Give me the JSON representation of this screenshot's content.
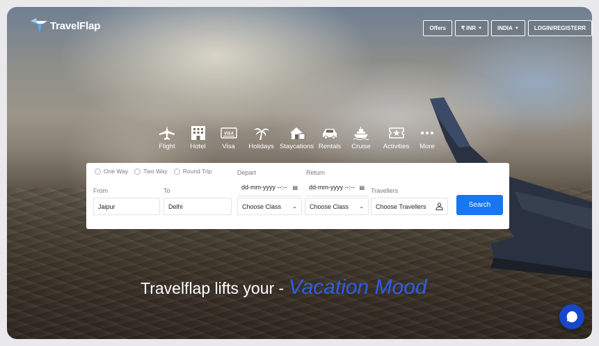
{
  "header": {
    "brand": "TravelFlap",
    "buttons": {
      "offers": "Offers",
      "currency": "₹ INR",
      "country": "INDIA",
      "login": "LOGIN/REGISTERR"
    }
  },
  "categories": [
    {
      "label": "Flight",
      "icon": "plane-icon"
    },
    {
      "label": "Hotel",
      "icon": "building-icon"
    },
    {
      "label": "Visa",
      "icon": "visa-card-icon"
    },
    {
      "label": "Holidays",
      "icon": "palm-tree-icon"
    },
    {
      "label": "Staycations",
      "icon": "house-icon"
    },
    {
      "label": "Rentals",
      "icon": "car-icon"
    },
    {
      "label": "Cruise",
      "icon": "ship-icon"
    },
    {
      "label": "Activities",
      "icon": "ticket-star-icon"
    },
    {
      "label": "More",
      "icon": "dots-icon"
    }
  ],
  "search": {
    "trip_types": [
      "One Way",
      "Two Way",
      "Round Trip"
    ],
    "labels": {
      "from": "From",
      "to": "To",
      "depart": "Depart",
      "return": "Return",
      "travellers": "Travellers"
    },
    "from_value": "Jaipur",
    "to_value": "Delhi",
    "depart_placeholder": "dd-mm-yyyy --:--",
    "return_placeholder": "dd-mm-yyyy --:--",
    "depart_class": "Choose Class",
    "return_class": "Choose Class",
    "travellers_value": "Choose Travellers",
    "submit": "Search"
  },
  "tagline": {
    "prefix": "Travelflap lifts your - ",
    "highlight": "Vacation Mood"
  },
  "colors": {
    "accent": "#1677f0",
    "highlight": "#2f5de8",
    "chat": "#1747c9"
  }
}
